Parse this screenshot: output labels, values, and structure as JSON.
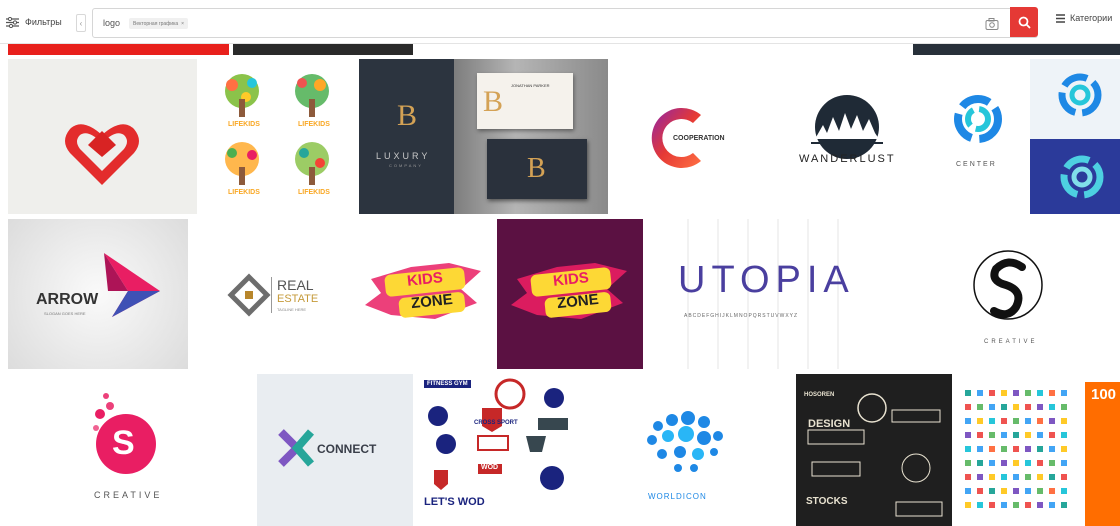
{
  "toolbar": {
    "filters_label": "Фильтры",
    "collapse_label": "‹",
    "search_query": "logo",
    "chip_label": "Векторная графика",
    "chip_close": "×",
    "categories_label": "Категории"
  },
  "icons": {
    "filters": "sliders-icon",
    "camera": "camera-icon",
    "search": "search-icon",
    "categories": "list-icon"
  },
  "colors": {
    "accent": "#e53935",
    "ink": "#333333"
  },
  "results": {
    "row1": [
      {
        "id": "heart"
      },
      {
        "id": "lifekids",
        "text": "LIFEKIDS"
      },
      {
        "id": "luxury",
        "text": "LUXURY",
        "sub": "COMPANY",
        "card": "JONATHAN PARKER"
      },
      {
        "id": "cooperation",
        "text": "COOPERATION"
      },
      {
        "id": "wanderlust",
        "text": "WANDERLUST"
      },
      {
        "id": "center",
        "text": "CENTER"
      }
    ],
    "row2": [
      {
        "id": "arrow",
        "text": "ARROW",
        "sub": "SLOGAN GOES HERE"
      },
      {
        "id": "realestate",
        "text1": "REAL",
        "text2": "ESTATE",
        "sub": "TAGLINE HERE"
      },
      {
        "id": "kidszone1",
        "text1": "KIDS",
        "text2": "ZONE"
      },
      {
        "id": "kidszone2",
        "text1": "KIDS",
        "text2": "ZONE"
      },
      {
        "id": "utopia",
        "text": "UTOPIA",
        "sub": "ABCDEFGHIJKLMNOPQRSTUVWXYZ"
      },
      {
        "id": "creative-s",
        "letter": "S",
        "text": "CREATIVE"
      }
    ],
    "row3": [
      {
        "id": "creative-pink",
        "letter": "S",
        "text": "CREATIVE"
      },
      {
        "id": "connect",
        "text": "CONNECT"
      },
      {
        "id": "fitness",
        "text1": "FITNESS GYM",
        "text2": "CROSS SPORT",
        "text3": "WOD",
        "text4": "LET'S WOD"
      },
      {
        "id": "worldicon",
        "text": "WORLDICON"
      },
      {
        "id": "vintage",
        "text1": "HOSOREN",
        "text2": "DESIGN",
        "text3": "STOCKS"
      },
      {
        "id": "icons100",
        "text": "100"
      }
    ]
  }
}
